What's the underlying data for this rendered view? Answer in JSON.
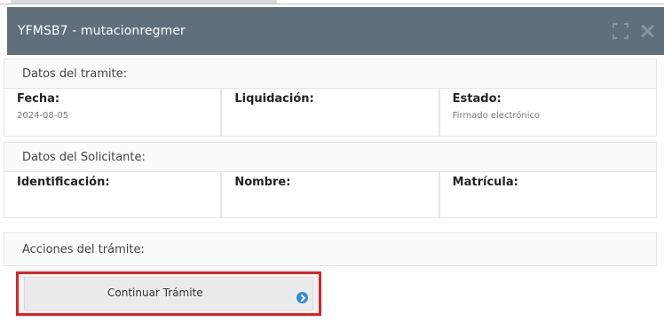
{
  "modal": {
    "title": "YFMSB7 - mutacionregmer"
  },
  "tramite": {
    "section_title": "Datos del tramite:",
    "fields": [
      {
        "label": "Fecha:",
        "value": "2024-08-05"
      },
      {
        "label": "Liquidación:",
        "value": ""
      },
      {
        "label": "Estado:",
        "value": "Firmado electrónico"
      }
    ]
  },
  "solicitante": {
    "section_title": "Datos del Solicitante:",
    "fields": [
      {
        "label": "Identificación:",
        "value": ""
      },
      {
        "label": "Nombre:",
        "value": ""
      },
      {
        "label": "Matrícula:",
        "value": ""
      }
    ]
  },
  "acciones": {
    "section_title": "Acciones del trámite:",
    "continue_label": "Continuar Trámite"
  },
  "colors": {
    "header_bg": "#5f6f7c",
    "highlight": "#e02025",
    "arrow": "#2f8cdc"
  }
}
